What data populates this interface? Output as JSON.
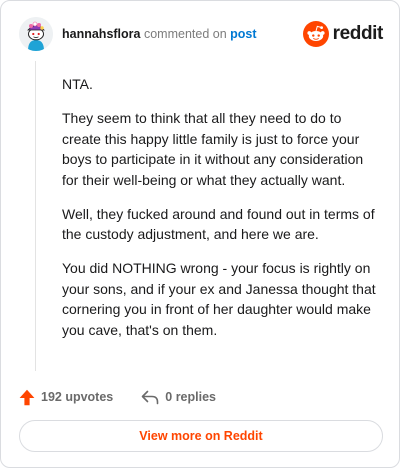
{
  "header": {
    "username": "hannahsflora",
    "action_text": "commented on",
    "post_link": "post",
    "brand_name": "reddit",
    "brand_color": "#ff4500"
  },
  "comment": {
    "paragraphs": [
      "NTA.",
      "They seem to think that all they need to do to create this happy little family is just to force your boys to participate in it without any consideration for their well-being or what they actually want.",
      "Well, they fucked around and found out in terms of the custody adjustment, and here we are.",
      "You did NOTHING wrong - your focus is rightly on your sons, and if your ex and Janessa thought that cornering you in front of her daughter would make you cave, that's on them."
    ]
  },
  "actions": {
    "upvotes": "192 upvotes",
    "upvote_icon": "upvote-arrow-icon",
    "replies": "0 replies",
    "reply_icon": "reply-arrow-icon"
  },
  "footer": {
    "view_more_label": "View more on Reddit"
  }
}
